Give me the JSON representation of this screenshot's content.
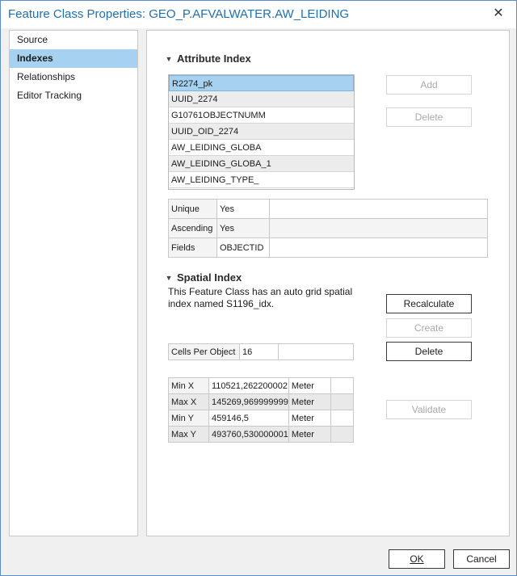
{
  "window": {
    "title": "Feature Class Properties: GEO_P.AFVALWATER.AW_LEIDING",
    "close_glyph": "✕"
  },
  "sidebar": {
    "items": [
      {
        "label": "Source"
      },
      {
        "label": "Indexes"
      },
      {
        "label": "Relationships"
      },
      {
        "label": "Editor Tracking"
      }
    ]
  },
  "attribute_index": {
    "heading": "Attribute Index",
    "items": [
      "R2274_pk",
      "UUID_2274",
      "G10761OBJECTNUMM",
      "UUID_OID_2274",
      "AW_LEIDING_GLOBA",
      "AW_LEIDING_GLOBA_1",
      "AW_LEIDING_TYPE_"
    ],
    "add_label": "Add",
    "delete_label": "Delete",
    "props": [
      {
        "label": "Unique",
        "value": "Yes"
      },
      {
        "label": "Ascending",
        "value": "Yes"
      },
      {
        "label": "Fields",
        "value": "OBJECTID"
      }
    ]
  },
  "spatial_index": {
    "heading": "Spatial Index",
    "description": "This Feature Class has an auto grid spatial index named S1196_idx.",
    "recalculate_label": "Recalculate",
    "create_label": "Create",
    "delete_label": "Delete",
    "validate_label": "Validate",
    "cells_label": "Cells Per Object",
    "cells_value": "16",
    "extent": [
      {
        "label": "Min X",
        "value": "110521,262200002",
        "unit": "Meter"
      },
      {
        "label": "Max X",
        "value": "145269,969999999",
        "unit": "Meter"
      },
      {
        "label": "Min Y",
        "value": "459146,5",
        "unit": "Meter"
      },
      {
        "label": "Max Y",
        "value": "493760,530000001",
        "unit": "Meter"
      }
    ]
  },
  "footer": {
    "ok_label": "OK",
    "cancel_label": "Cancel"
  },
  "colors": {
    "title": "#1e6fb3",
    "selection": "#a7d1f0"
  }
}
